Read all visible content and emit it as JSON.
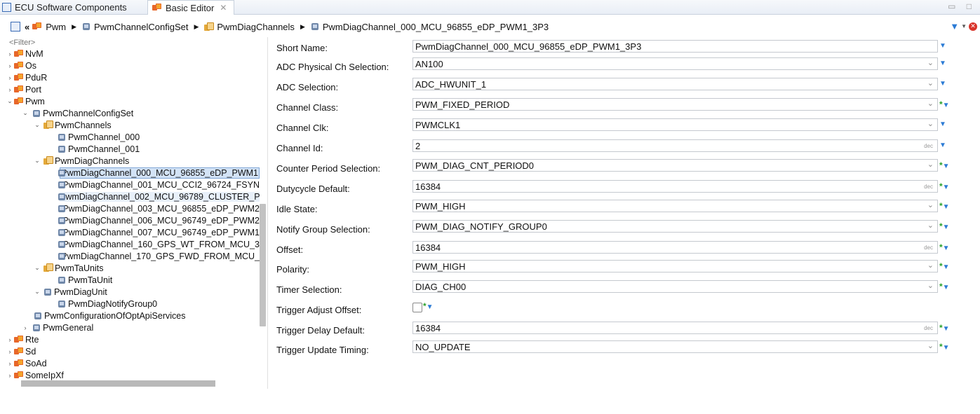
{
  "tabs": {
    "ecu": "ECU Software Components",
    "basic": "Basic Editor",
    "close": "✕"
  },
  "window_controls": "▭ □",
  "breadcrumb": {
    "items": [
      "Pwm",
      "PwmChannelConfigSet",
      "PwmDiagChannels",
      "PwmDiagChannel_000_MCU_96855_eDP_PWM1_3P3"
    ],
    "back": "«"
  },
  "tree": {
    "filter_placeholder": "<Filter>",
    "rows": [
      {
        "label": "NvM"
      },
      {
        "label": "Os"
      },
      {
        "label": "PduR"
      },
      {
        "label": "Port"
      },
      {
        "label": "Pwm"
      },
      {
        "label": "PwmChannelConfigSet"
      },
      {
        "label": "PwmChannels"
      },
      {
        "label": "PwmChannel_000"
      },
      {
        "label": "PwmChannel_001"
      },
      {
        "label": "PwmDiagChannels"
      },
      {
        "label": "PwmDiagChannel_000_MCU_96855_eDP_PWM1"
      },
      {
        "label": "PwmDiagChannel_001_MCU_CCI2_96724_FSYN"
      },
      {
        "label": "PwmDiagChannel_002_MCU_96789_CLUSTER_P"
      },
      {
        "label": "PwmDiagChannel_003_MCU_96855_eDP_PWM2"
      },
      {
        "label": "PwmDiagChannel_006_MCU_96749_eDP_PWM2"
      },
      {
        "label": "PwmDiagChannel_007_MCU_96749_eDP_PWM1"
      },
      {
        "label": "PwmDiagChannel_160_GPS_WT_FROM_MCU_3"
      },
      {
        "label": "PwmDiagChannel_170_GPS_FWD_FROM_MCU_"
      },
      {
        "label": "PwmTaUnits"
      },
      {
        "label": "PwmTaUnit"
      },
      {
        "label": "PwmDiagUnit"
      },
      {
        "label": "PwmDiagNotifyGroup0"
      },
      {
        "label": "PwmConfigurationOfOptApiServices"
      },
      {
        "label": "PwmGeneral"
      },
      {
        "label": "Rte"
      },
      {
        "label": "Sd"
      },
      {
        "label": "SoAd"
      },
      {
        "label": "SomeIpXf"
      }
    ]
  },
  "form": {
    "short_name": {
      "label": "Short Name:",
      "value": "PwmDiagChannel_000_MCU_96855_eDP_PWM1_3P3"
    },
    "adc_phys": {
      "label": "ADC Physical Ch Selection:",
      "value": "AN100"
    },
    "adc_sel": {
      "label": "ADC Selection:",
      "value": "ADC_HWUNIT_1"
    },
    "ch_class": {
      "label": "Channel Class:",
      "value": "PWM_FIXED_PERIOD"
    },
    "ch_clk": {
      "label": "Channel Clk:",
      "value": "PWMCLK1"
    },
    "ch_id": {
      "label": "Channel Id:",
      "value": "2",
      "unit": "dec"
    },
    "counter_period": {
      "label": "Counter Period Selection:",
      "value": "PWM_DIAG_CNT_PERIOD0"
    },
    "dutycycle": {
      "label": "Dutycycle Default:",
      "value": "16384",
      "unit": "dec"
    },
    "idle_state": {
      "label": "Idle State:",
      "value": "PWM_HIGH"
    },
    "notify_group": {
      "label": "Notify Group Selection:",
      "value": "PWM_DIAG_NOTIFY_GROUP0"
    },
    "offset": {
      "label": "Offset:",
      "value": "16384",
      "unit": "dec"
    },
    "polarity": {
      "label": "Polarity:",
      "value": "PWM_HIGH"
    },
    "timer_sel": {
      "label": "Timer Selection:",
      "value": "DIAG_CH00"
    },
    "trig_adjust": {
      "label": "Trigger Adjust Offset:"
    },
    "trig_delay": {
      "label": "Trigger Delay Default:",
      "value": "16384",
      "unit": "dec"
    },
    "trig_update": {
      "label": "Trigger Update Timing:",
      "value": "NO_UPDATE"
    }
  },
  "colors": {
    "accent": "#2b7bd5",
    "star": "#2aa02a",
    "selection": "#d3e3f6"
  }
}
